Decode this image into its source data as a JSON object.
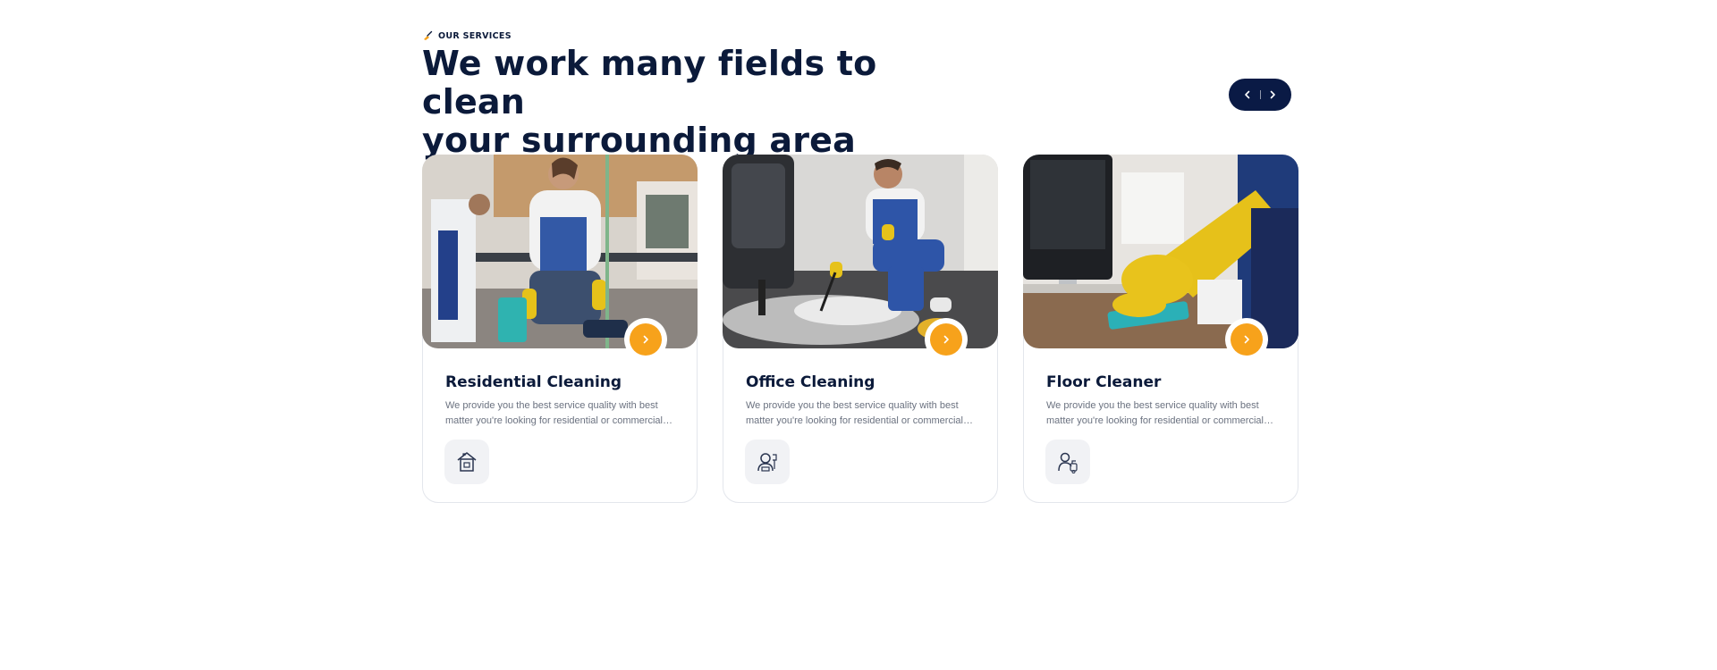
{
  "header": {
    "eyebrow_icon": "broom-icon",
    "eyebrow": "OUR SERVICES",
    "heading_line1": "We work many fields to clean",
    "heading_line2": "your surrounding area"
  },
  "carousel": {
    "prev_icon": "chevron-left-icon",
    "next_icon": "chevron-right-icon"
  },
  "colors": {
    "navy": "#0a1a45",
    "accent": "#f7a21b",
    "text_muted": "#6b7280"
  },
  "services": [
    {
      "title": "Residential Cleaning",
      "description": "We provide you the best service quality with best matter you're looking for residential or commercial services.",
      "photo": "cleaner-vacuuming-office-photo",
      "icon": "house-icon"
    },
    {
      "title": "Office Cleaning",
      "description": "We provide you the best service quality with best matter you're looking for residential or commercial services.",
      "photo": "cleaner-steam-cleaning-floor-photo",
      "icon": "office-worker-icon"
    },
    {
      "title": "Floor Cleaner",
      "description": "We provide you the best service quality with best matter you're looking for residential or commercial services.",
      "photo": "gloved-hand-wiping-desk-photo",
      "icon": "cleaner-spray-icon"
    }
  ]
}
